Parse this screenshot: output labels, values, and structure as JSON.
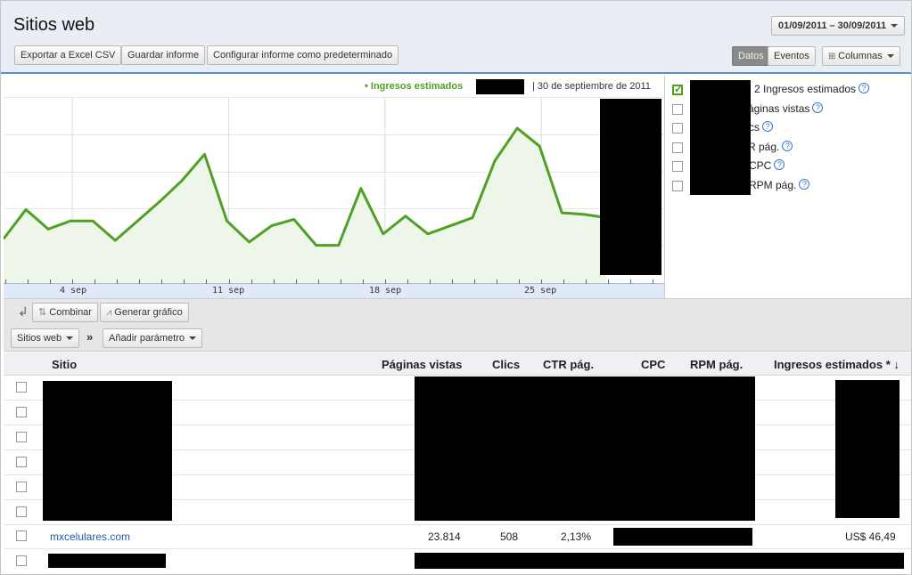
{
  "header": {
    "title": "Sitios web",
    "date_range": "01/09/2011 – 30/09/2011",
    "buttons": {
      "export_csv": "Exportar a Excel CSV",
      "save_report": "Guardar informe",
      "set_default": "Configurar informe como predeterminado",
      "datos": "Datos",
      "eventos": "Eventos",
      "columnas": "Columnas"
    }
  },
  "chart": {
    "legend_series": "• Ingresos estimados",
    "legend_date": "| 30 de septiembre de 2011",
    "x_ticks": [
      "4 sep",
      "11 sep",
      "18 sep",
      "25 sep"
    ]
  },
  "chart_data": {
    "type": "line",
    "x": [
      "1 sep",
      "2 sep",
      "3 sep",
      "4 sep",
      "5 sep",
      "6 sep",
      "7 sep",
      "8 sep",
      "9 sep",
      "10 sep",
      "11 sep",
      "12 sep",
      "13 sep",
      "14 sep",
      "15 sep",
      "16 sep",
      "17 sep",
      "18 sep",
      "19 sep",
      "20 sep",
      "21 sep",
      "22 sep",
      "23 sep",
      "24 sep",
      "25 sep",
      "26 sep",
      "27 sep",
      "28 sep"
    ],
    "series": [
      {
        "name": "Ingresos estimados",
        "values": [
          25,
          43,
          31,
          36,
          36,
          24,
          36,
          48,
          61,
          77,
          36,
          23,
          33,
          37,
          21,
          21,
          56,
          28,
          39,
          28,
          33,
          38,
          73,
          93,
          82,
          41,
          40,
          38
        ]
      }
    ],
    "ylim": [
      0,
      110
    ],
    "grid": true,
    "color": "#4ea125"
  },
  "metrics": [
    {
      "label": "2  Ingresos estimados",
      "checked": true
    },
    {
      "label": "áginas vistas",
      "checked": false
    },
    {
      "label": "cs",
      "checked": false
    },
    {
      "label": "R pág.",
      "checked": false
    },
    {
      "label": "CPC",
      "checked": false
    },
    {
      "label": "RPM pág.",
      "checked": false
    }
  ],
  "toolbar": {
    "combinar": "Combinar",
    "generar_grafico": "Generar gráfico",
    "sitios_web": "Sitios web",
    "raquo": "»",
    "anadir_parametro": "Añadir parámetro"
  },
  "table": {
    "headers": {
      "sitio": "Sitio",
      "paginas_vistas": "Páginas vistas",
      "clics": "Clics",
      "ctr": "CTR pág.",
      "cpc": "CPC",
      "rpm": "RPM pág.",
      "ingresos": "Ingresos estimados * ↓"
    },
    "visible_row": {
      "site": "mxcelulares.com",
      "paginas_vistas": "23.814",
      "clics": "508",
      "ctr": "2,13%",
      "ingresos": "US$ 46,49"
    }
  },
  "colors": {
    "accent": "#4ea125",
    "header_bg": "#e9eef4",
    "link": "#1f5ea8"
  }
}
